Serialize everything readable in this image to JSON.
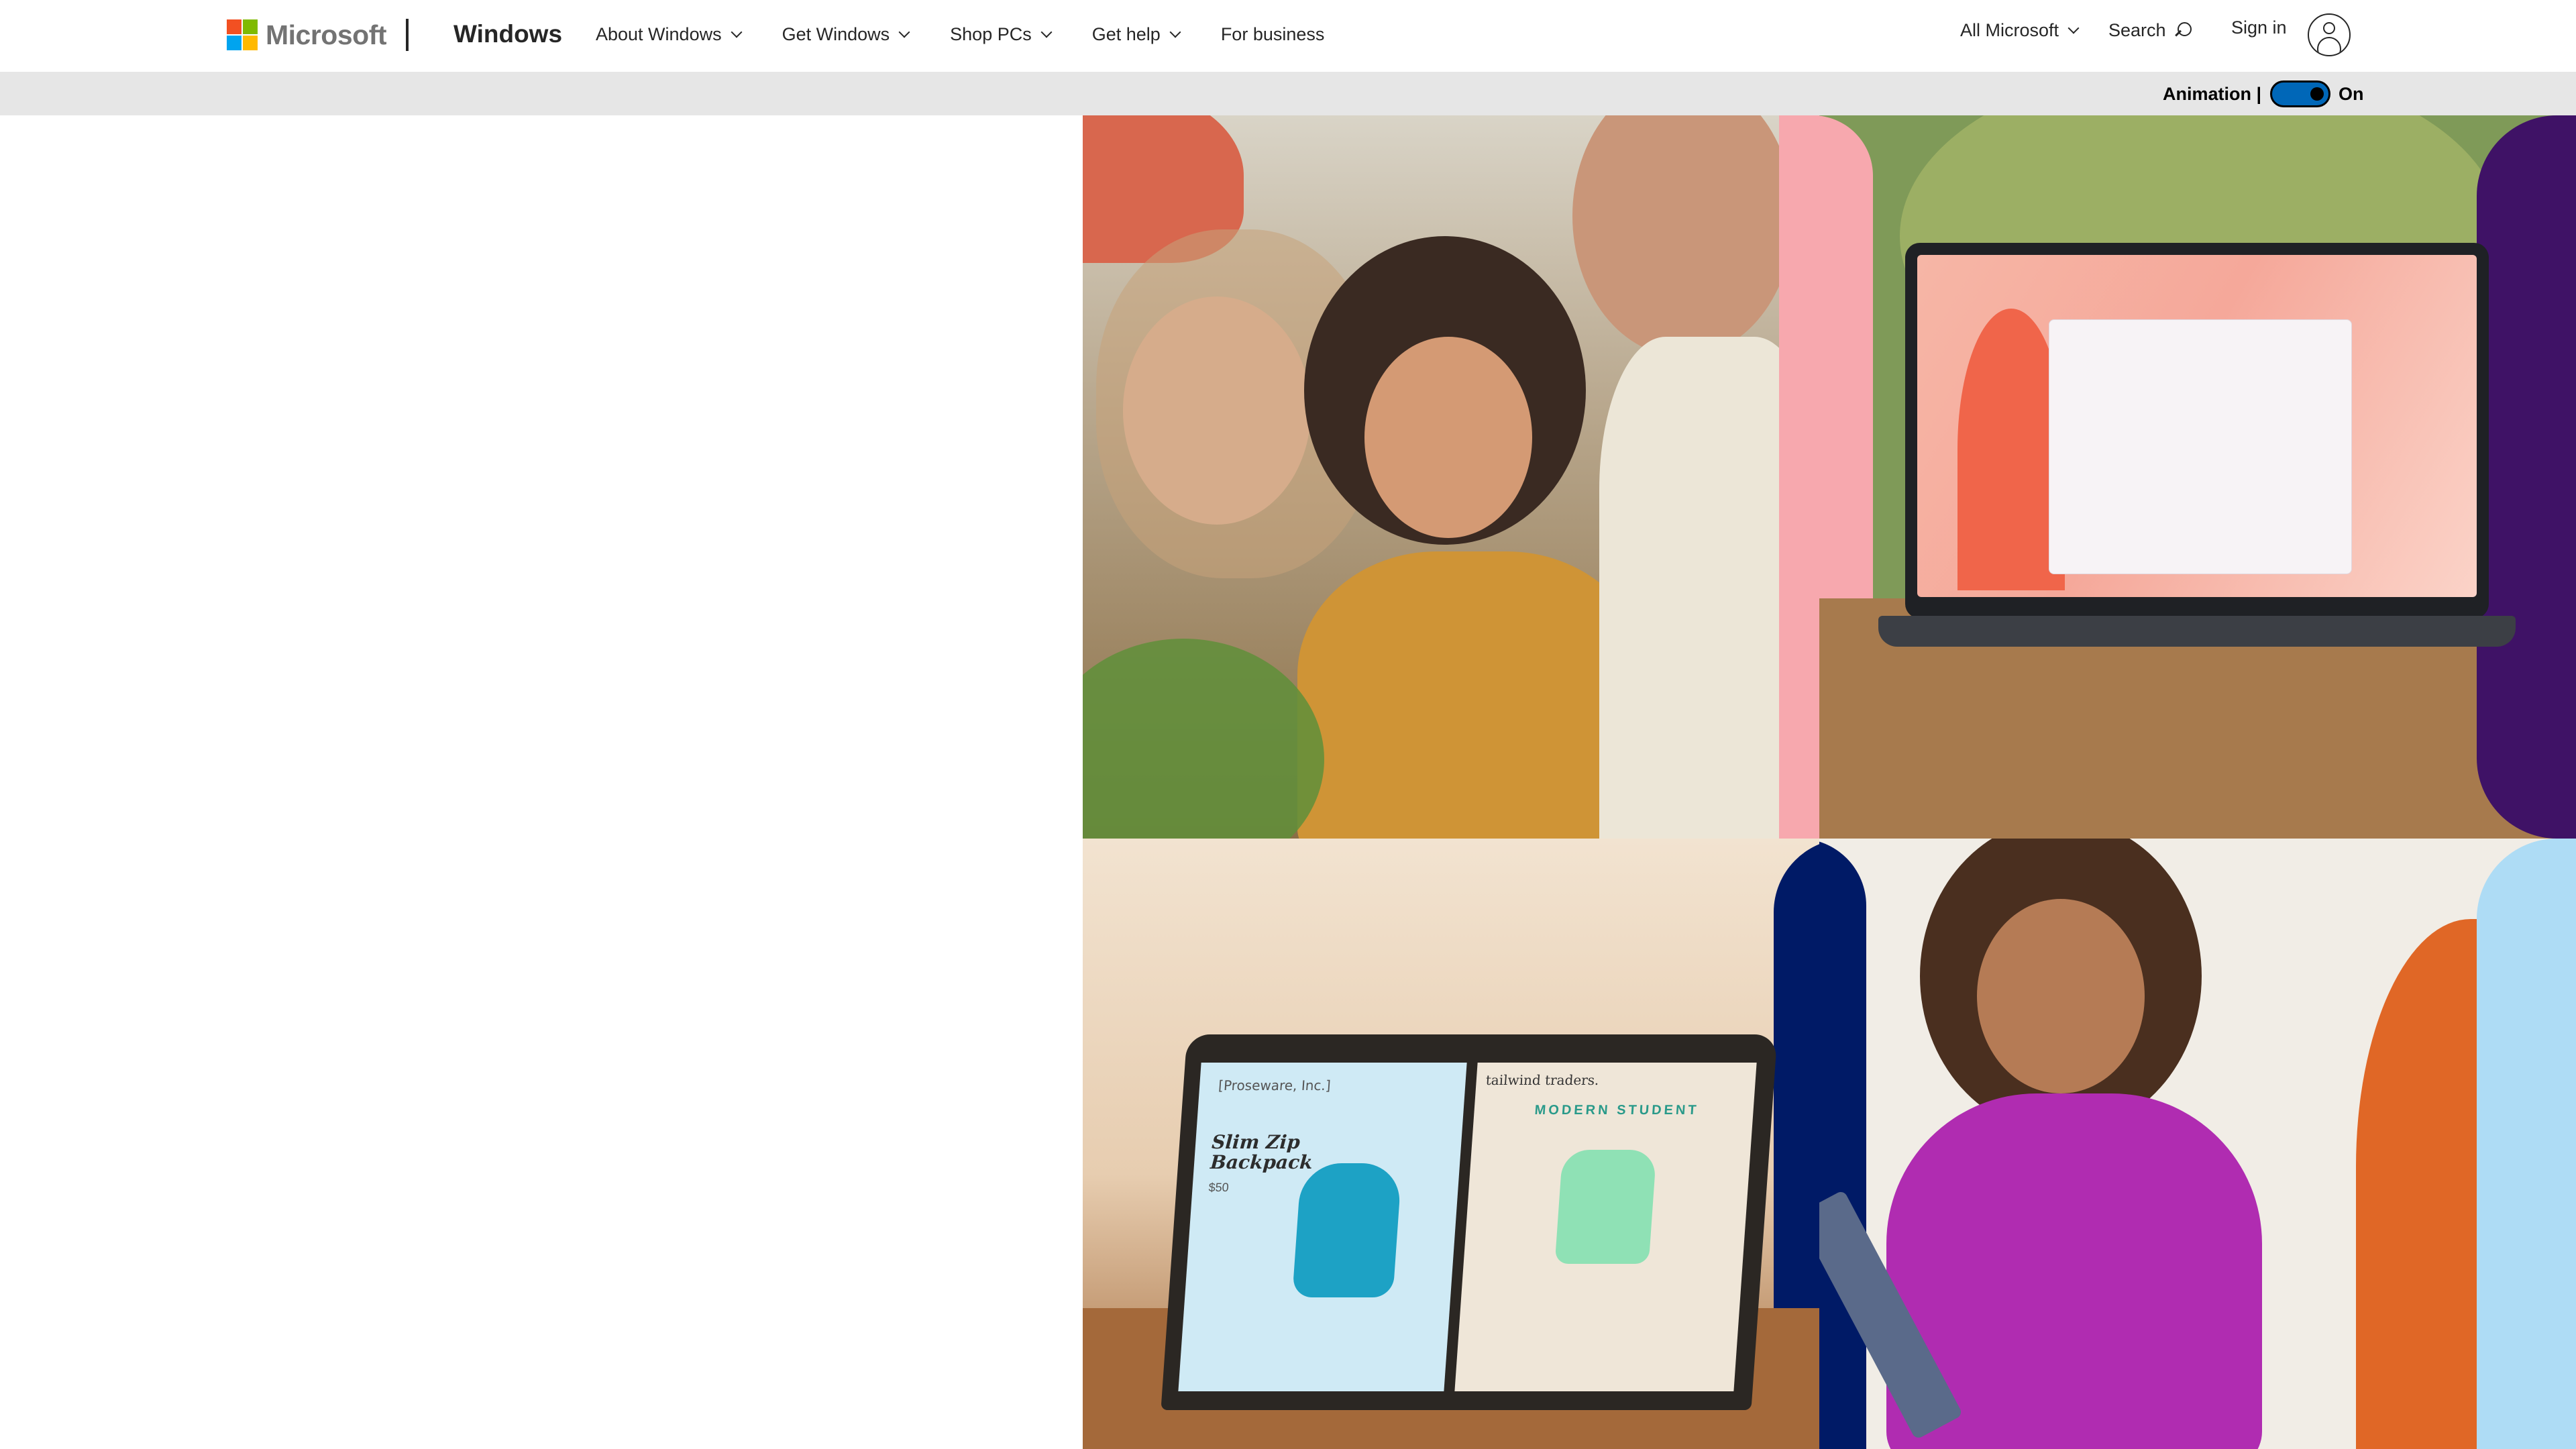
{
  "header": {
    "logo_text": "Microsoft",
    "logo_colors": [
      "#f25022",
      "#7fba00",
      "#00a4ef",
      "#ffb900"
    ],
    "product_name": "Windows",
    "nav": [
      {
        "label": "About Windows",
        "has_dropdown": true
      },
      {
        "label": "Get Windows",
        "has_dropdown": true
      },
      {
        "label": "Shop PCs",
        "has_dropdown": true
      },
      {
        "label": "Get help",
        "has_dropdown": true
      },
      {
        "label": "For business",
        "has_dropdown": false
      }
    ],
    "all_microsoft": "All Microsoft",
    "search_label": "Search",
    "sign_in": "Sign in"
  },
  "animation": {
    "label": "Animation |",
    "state": "On",
    "toggle_color": "#0067b8"
  },
  "hero": {
    "laptop_left_store": "[Proseware, Inc.]",
    "laptop_left_product": "Slim Zip Backpack",
    "laptop_left_price": "$50",
    "laptop_right_store": "tailwind traders.",
    "laptop_right_heading": "MODERN STUDENT"
  },
  "icons": {
    "search": "search-icon",
    "avatar": "account-icon",
    "chevron": "chevron-down-icon"
  }
}
